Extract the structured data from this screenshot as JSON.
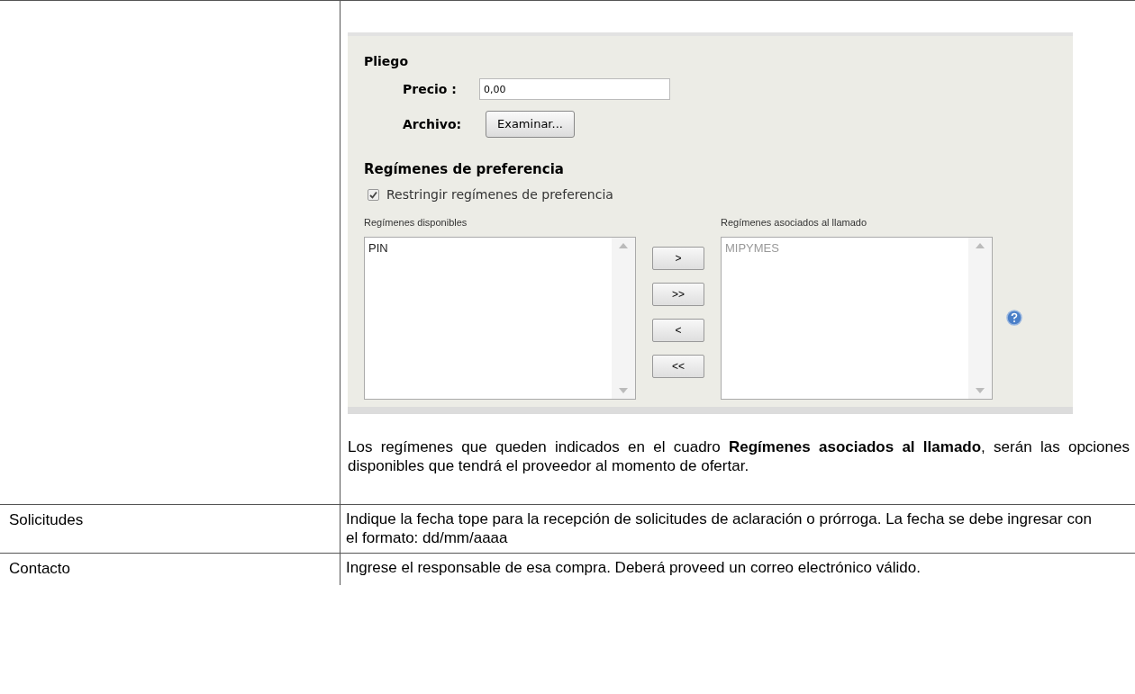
{
  "first_row": {
    "form": {
      "section_title": "Pliego",
      "price": {
        "label": "Precio :",
        "value": "0,00"
      },
      "file": {
        "label": "Archivo:",
        "button": "Examinar..."
      },
      "preferences": {
        "title": "Regímenes de preferencia",
        "restrict": {
          "label": "Restringir regímenes de preferencia",
          "checked": true
        },
        "available": {
          "label": "Regímenes disponibles",
          "items": [
            "PIN"
          ],
          "disabled": false
        },
        "associated": {
          "label": "Regímenes asociados al llamado",
          "items": [
            "MIPYMES"
          ],
          "disabled": true
        },
        "move_buttons": [
          ">",
          ">>",
          "<",
          "<<"
        ]
      }
    },
    "note": "Los regímenes que queden indicados en el cuadro **Regímenes asociados al llamado**, serán las opciones disponibles que tendrá el proveedor al momento de ofertar."
  },
  "rows": [
    {
      "label": "Solicitudes",
      "description": "Indique la fecha tope para la recepción de solicitudes de aclaración o prórroga. La fecha se debe ingresar con el formato: dd/mm/aaaa"
    },
    {
      "label": "Contacto",
      "description": "Ingrese el responsable de esa compra. Deberá proveed un correo electrónico válido."
    }
  ]
}
